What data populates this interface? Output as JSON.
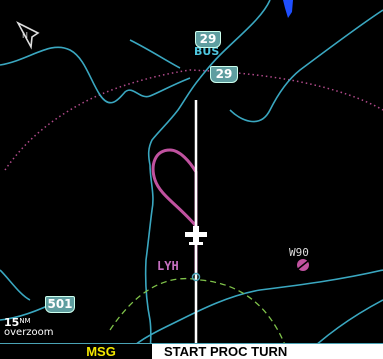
{
  "map": {
    "north_icon": "north-arrow-icon",
    "highway_shields": [
      {
        "number": "29",
        "sub_label": "BUS"
      },
      {
        "number": "29"
      },
      {
        "number": "501"
      }
    ],
    "airports": [
      {
        "id": "LYH",
        "role": "destination"
      },
      {
        "id": "W90",
        "role": "nearby"
      }
    ],
    "zoom": {
      "range": "15",
      "unit": "NM",
      "mode": "overzoom"
    },
    "colors": {
      "background": "#000000",
      "course_line": "#ffffff",
      "procedure_turn": "#c0529f",
      "roads": "#4aa3b5",
      "range_ring": "#b04a8a",
      "airspace_dashed": "#7fc24a",
      "water": "#1f4fff"
    }
  },
  "status_bar": {
    "msg_label": "MSG",
    "message": "START PROC TURN",
    "msg_color": "#f2e600"
  }
}
